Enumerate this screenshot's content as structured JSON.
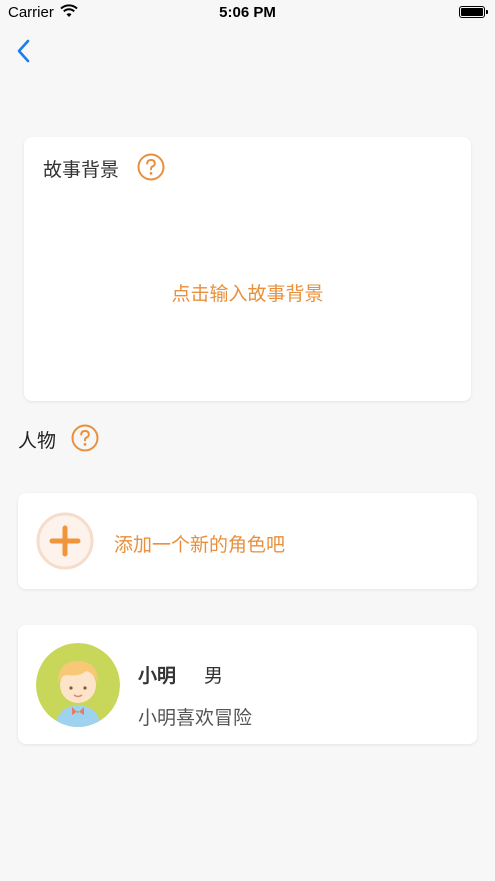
{
  "status_bar": {
    "carrier": "Carrier",
    "time": "5:06 PM"
  },
  "story": {
    "title": "故事背景",
    "placeholder": "点击输入故事背景"
  },
  "people": {
    "label": "人物"
  },
  "add_character": {
    "label": "添加一个新的角色吧"
  },
  "characters": [
    {
      "name": "小明",
      "gender": "男",
      "description": "小明喜欢冒险"
    }
  ],
  "colors": {
    "accent": "#e8903c",
    "back": "#1a7cf0",
    "background": "#f7f7f7"
  }
}
